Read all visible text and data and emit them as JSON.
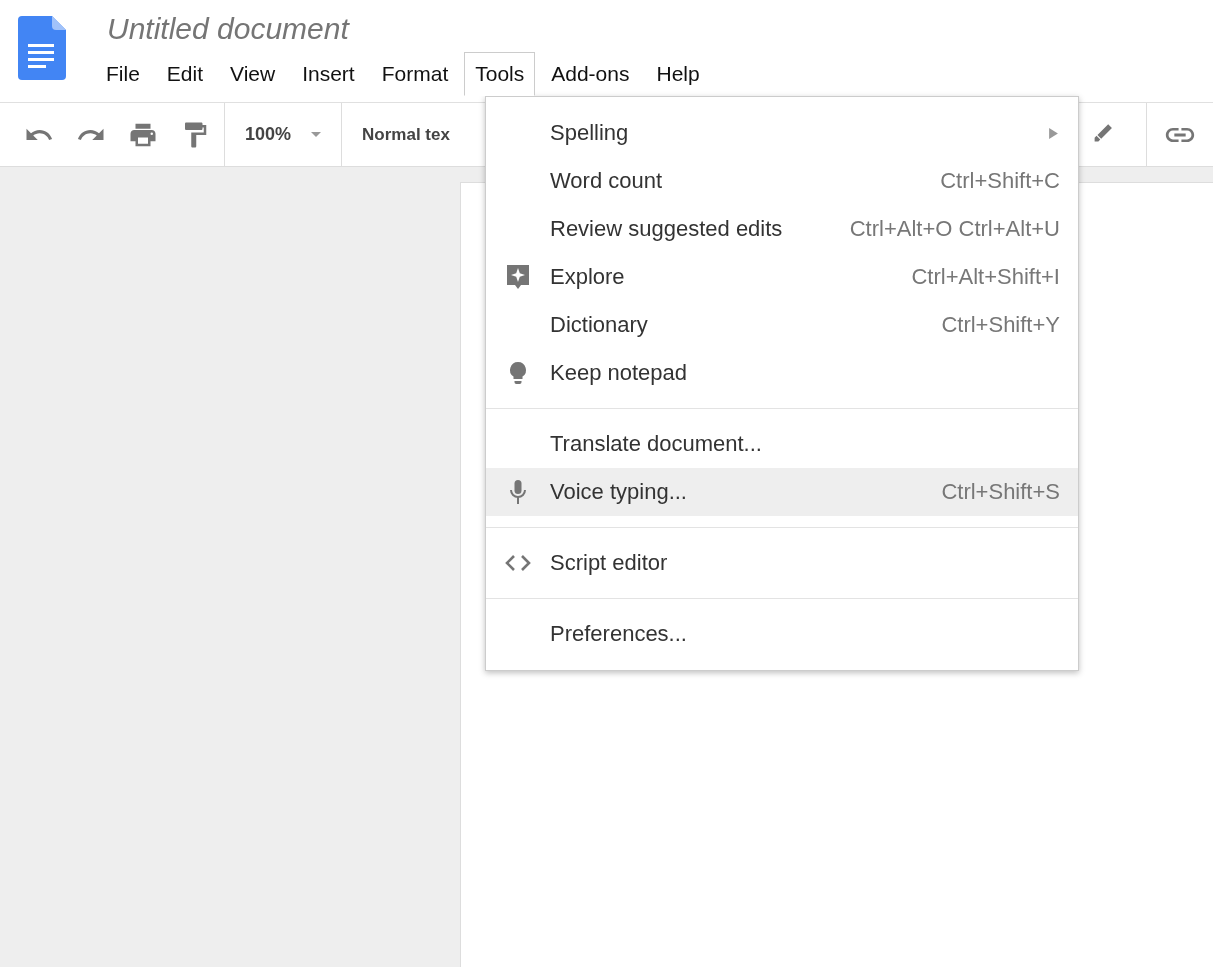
{
  "document": {
    "title": "Untitled document"
  },
  "menu_bar": [
    {
      "label": "File",
      "selected": false
    },
    {
      "label": "Edit",
      "selected": false
    },
    {
      "label": "View",
      "selected": false
    },
    {
      "label": "Insert",
      "selected": false
    },
    {
      "label": "Format",
      "selected": false
    },
    {
      "label": "Tools",
      "selected": true
    },
    {
      "label": "Add-ons",
      "selected": false
    },
    {
      "label": "Help",
      "selected": false
    }
  ],
  "toolbar": {
    "zoom": "100%",
    "style": "Normal tex"
  },
  "tools_menu": {
    "sections": [
      [
        {
          "label": "Spelling",
          "submenu": true,
          "selected": false
        },
        {
          "label": "Word count",
          "shortcut": "Ctrl+Shift+C",
          "selected": false
        },
        {
          "label": "Review suggested edits",
          "shortcut": "Ctrl+Alt+O Ctrl+Alt+U",
          "selected": false
        },
        {
          "label": "Explore",
          "shortcut": "Ctrl+Alt+Shift+I",
          "kind": "explore",
          "selected": false
        },
        {
          "label": "Dictionary",
          "shortcut": "Ctrl+Shift+Y",
          "selected": false
        },
        {
          "label": "Keep notepad",
          "kind": "bulb",
          "selected": false
        }
      ],
      [
        {
          "label": "Translate document...",
          "selected": false
        },
        {
          "label": "Voice typing...",
          "shortcut": "Ctrl+Shift+S",
          "kind": "mic",
          "selected": true
        }
      ],
      [
        {
          "label": "Script editor",
          "kind": "code",
          "selected": false
        }
      ],
      [
        {
          "label": "Preferences...",
          "selected": false
        }
      ]
    ]
  }
}
